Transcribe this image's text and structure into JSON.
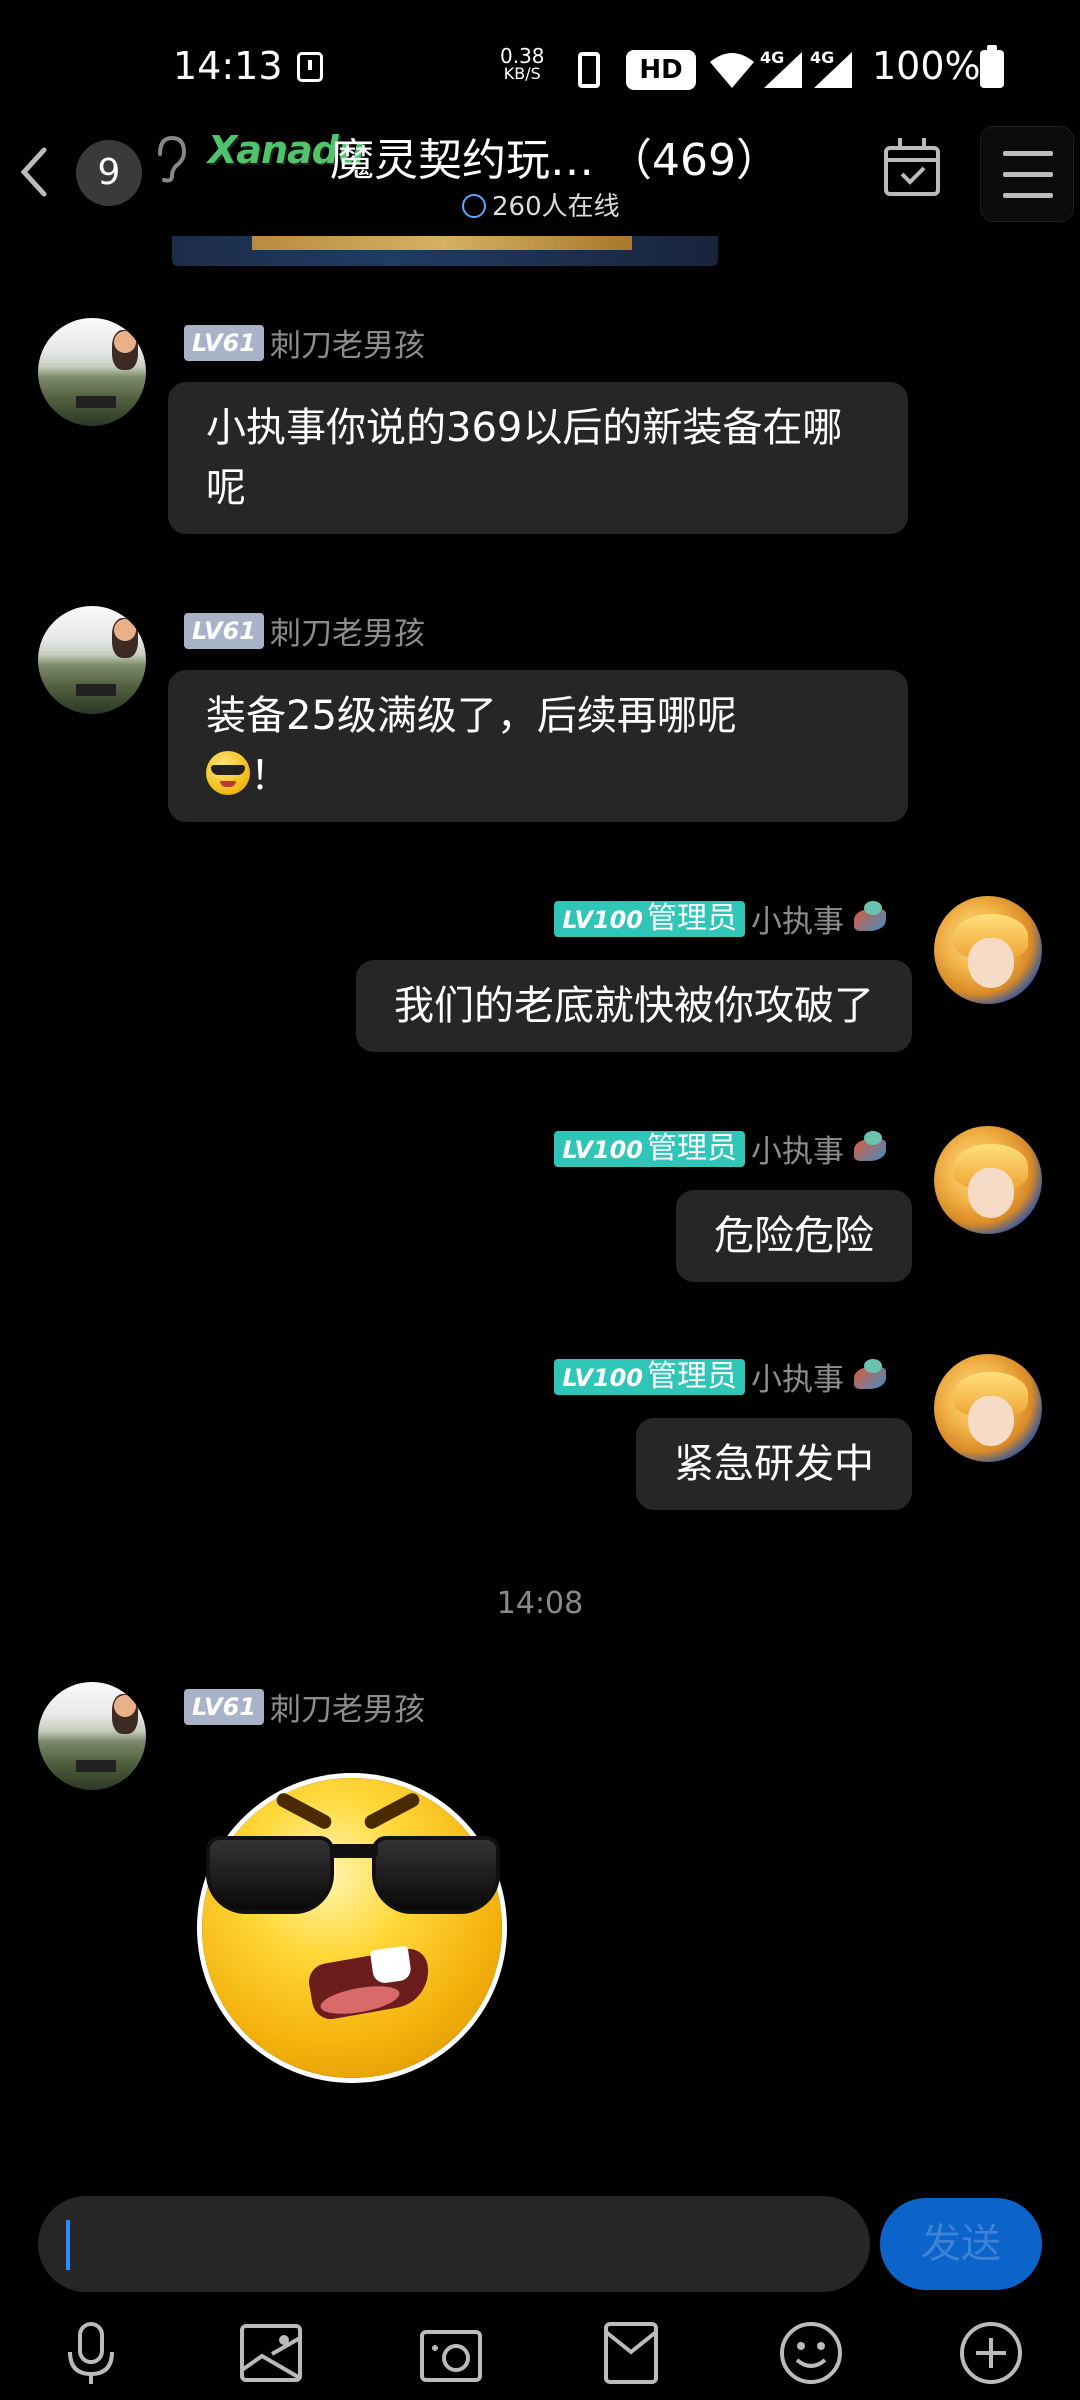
{
  "status_bar": {
    "time": "14:13",
    "net_speed_value": "0.38",
    "net_speed_unit": "KB/S",
    "hd_label": "HD",
    "net_type_1": "4G",
    "net_type_2": "4G",
    "battery": "100%"
  },
  "header": {
    "unread_count": "9",
    "logo_text": "Xanadu",
    "title": "魔灵契约玩… （469）",
    "online": "260人在线"
  },
  "messages": [
    {
      "side": "left",
      "level": "LV61",
      "nickname": "刺刀老男孩",
      "text": "小执事你说的369以后的新装备在哪呢"
    },
    {
      "side": "left",
      "level": "LV61",
      "nickname": "刺刀老男孩",
      "text": "装备25级满级了，后续再哪呢",
      "text_suffix": "！"
    },
    {
      "side": "right",
      "level": "LV100",
      "role": "管理员",
      "nickname": "小执事",
      "text": "我们的老底就快被你攻破了"
    },
    {
      "side": "right",
      "level": "LV100",
      "role": "管理员",
      "nickname": "小执事",
      "text": "危险危险"
    },
    {
      "side": "right",
      "level": "LV100",
      "role": "管理员",
      "nickname": "小执事",
      "text": "紧急研发中"
    },
    {
      "side": "left",
      "level": "LV61",
      "nickname": "刺刀老男孩",
      "sticker": "cool-emoji-sticker"
    }
  ],
  "timestamp": "14:08",
  "input": {
    "send_label": "发送"
  },
  "toolbar": [
    "microphone-icon",
    "image-icon",
    "camera-icon",
    "red-packet-icon",
    "emoji-icon",
    "plus-icon"
  ],
  "colors": {
    "background": "#000000",
    "bubble": "#262626",
    "admin_badge": "#2fc6b8",
    "user_badge": "#a9b3c8",
    "send_button": "#0c63c9"
  }
}
